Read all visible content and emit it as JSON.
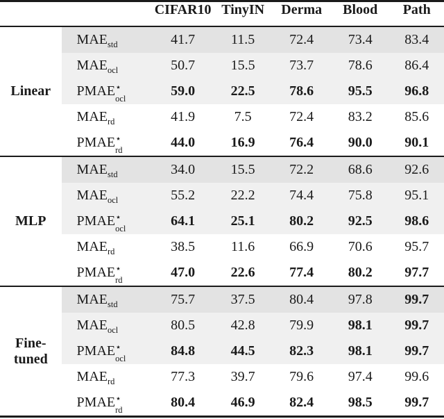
{
  "table": {
    "columns": [
      {
        "key": "method",
        "label": ""
      },
      {
        "key": "metric",
        "label": ""
      },
      {
        "key": "cifar10",
        "label": "CIFAR10"
      },
      {
        "key": "tinyin",
        "label": "TinyIN"
      },
      {
        "key": "derma",
        "label": "Derma"
      },
      {
        "key": "blood",
        "label": "Blood"
      },
      {
        "key": "path",
        "label": "Path"
      }
    ],
    "blocks": [
      {
        "method": "Linear",
        "method_lines": [
          "Linear"
        ],
        "rows": [
          {
            "metric": {
              "base": "MAE",
              "sub": "std",
              "star": false
            },
            "shade": "dark",
            "values": [
              "41.7",
              "11.5",
              "72.4",
              "73.4",
              "83.4"
            ],
            "bold": [
              false,
              false,
              false,
              false,
              false
            ]
          },
          {
            "metric": {
              "base": "MAE",
              "sub": "ocl",
              "star": false
            },
            "shade": "light",
            "values": [
              "50.7",
              "15.5",
              "73.7",
              "78.6",
              "86.4"
            ],
            "bold": [
              false,
              false,
              false,
              false,
              false
            ]
          },
          {
            "metric": {
              "base": "PMAE",
              "sub": "ocl",
              "star": true
            },
            "shade": "light",
            "values": [
              "59.0",
              "22.5",
              "78.6",
              "95.5",
              "96.8"
            ],
            "bold": [
              true,
              true,
              true,
              true,
              true
            ]
          },
          {
            "metric": {
              "base": "MAE",
              "sub": "rd",
              "star": false
            },
            "shade": "none",
            "values": [
              "41.9",
              "7.5",
              "72.4",
              "83.2",
              "85.6"
            ],
            "bold": [
              false,
              false,
              false,
              false,
              false
            ]
          },
          {
            "metric": {
              "base": "PMAE",
              "sub": "rd",
              "star": true
            },
            "shade": "none",
            "values": [
              "44.0",
              "16.9",
              "76.4",
              "90.0",
              "90.1"
            ],
            "bold": [
              true,
              true,
              true,
              true,
              true
            ]
          }
        ]
      },
      {
        "method": "MLP",
        "method_lines": [
          "MLP"
        ],
        "rows": [
          {
            "metric": {
              "base": "MAE",
              "sub": "std",
              "star": false
            },
            "shade": "dark",
            "values": [
              "34.0",
              "15.5",
              "72.2",
              "68.6",
              "92.6"
            ],
            "bold": [
              false,
              false,
              false,
              false,
              false
            ]
          },
          {
            "metric": {
              "base": "MAE",
              "sub": "ocl",
              "star": false
            },
            "shade": "light",
            "values": [
              "55.2",
              "22.2",
              "74.4",
              "75.8",
              "95.1"
            ],
            "bold": [
              false,
              false,
              false,
              false,
              false
            ]
          },
          {
            "metric": {
              "base": "PMAE",
              "sub": "ocl",
              "star": true
            },
            "shade": "light",
            "values": [
              "64.1",
              "25.1",
              "80.2",
              "92.5",
              "98.6"
            ],
            "bold": [
              true,
              true,
              true,
              true,
              true
            ]
          },
          {
            "metric": {
              "base": "MAE",
              "sub": "rd",
              "star": false
            },
            "shade": "none",
            "values": [
              "38.5",
              "11.6",
              "66.9",
              "70.6",
              "95.7"
            ],
            "bold": [
              false,
              false,
              false,
              false,
              false
            ]
          },
          {
            "metric": {
              "base": "PMAE",
              "sub": "rd",
              "star": true
            },
            "shade": "none",
            "values": [
              "47.0",
              "22.6",
              "77.4",
              "80.2",
              "97.7"
            ],
            "bold": [
              true,
              true,
              true,
              true,
              true
            ]
          }
        ]
      },
      {
        "method": "Fine-tuned",
        "method_lines": [
          "Fine-",
          "tuned"
        ],
        "rows": [
          {
            "metric": {
              "base": "MAE",
              "sub": "std",
              "star": false
            },
            "shade": "dark",
            "values": [
              "75.7",
              "37.5",
              "80.4",
              "97.8",
              "99.7"
            ],
            "bold": [
              false,
              false,
              false,
              false,
              true
            ]
          },
          {
            "metric": {
              "base": "MAE",
              "sub": "ocl",
              "star": false
            },
            "shade": "light",
            "values": [
              "80.5",
              "42.8",
              "79.9",
              "98.1",
              "99.7"
            ],
            "bold": [
              false,
              false,
              false,
              true,
              true
            ]
          },
          {
            "metric": {
              "base": "PMAE",
              "sub": "ocl",
              "star": true
            },
            "shade": "light",
            "values": [
              "84.8",
              "44.5",
              "82.3",
              "98.1",
              "99.7"
            ],
            "bold": [
              true,
              true,
              true,
              true,
              true
            ]
          },
          {
            "metric": {
              "base": "MAE",
              "sub": "rd",
              "star": false
            },
            "shade": "none",
            "values": [
              "77.3",
              "39.7",
              "79.6",
              "97.4",
              "99.6"
            ],
            "bold": [
              false,
              false,
              false,
              false,
              false
            ]
          },
          {
            "metric": {
              "base": "PMAE",
              "sub": "rd",
              "star": true
            },
            "shade": "none",
            "values": [
              "80.4",
              "46.9",
              "82.4",
              "98.5",
              "99.7"
            ],
            "bold": [
              true,
              true,
              true,
              true,
              true
            ]
          }
        ]
      }
    ]
  },
  "style": {
    "shade_dark": "#e3e3e3",
    "shade_light": "#f0f0f0",
    "rule_color": "#1a1a1a",
    "star_glyph": "⋆"
  }
}
